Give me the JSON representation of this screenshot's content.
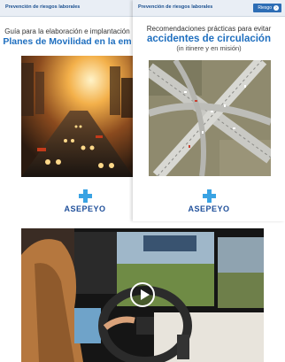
{
  "left_doc": {
    "header_label": "Prevención de riesgos laborales",
    "title_line1": "Guía para la elaboración e implantación",
    "title_line2": "Planes de Movilidad en la em"
  },
  "right_doc": {
    "header_label": "Prevención de riesgos laborales",
    "header_button": "Riesgo",
    "title_line1": "Recomendaciones prácticas para evitar",
    "title_line2": "accidentes de circulación",
    "title_line3": "(in itinere y en misión)"
  },
  "logo": {
    "name": "ASEPEYO"
  },
  "video": {
    "play_icon": "play-icon"
  },
  "colors": {
    "brand_blue": "#1f6fbf",
    "logo_cross": "#3aa3e3",
    "logo_text": "#1f4f9a"
  }
}
